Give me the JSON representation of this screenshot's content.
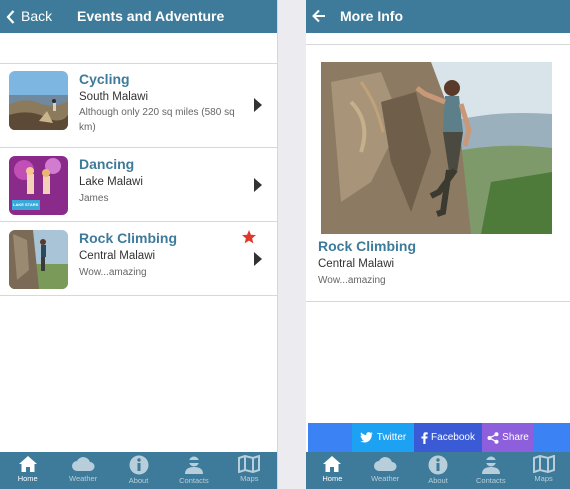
{
  "left": {
    "back_label": "Back",
    "title": "Events and Adventure",
    "items": [
      {
        "name": "Cycling",
        "location": "South Malawi",
        "description": "Although only 220 sq miles (580 sq km)",
        "favorite": false
      },
      {
        "name": "Dancing",
        "location": "Lake Malawi",
        "description": "James",
        "favorite": false
      },
      {
        "name": "Rock Climbing",
        "location": "Central Malawi",
        "description": "Wow...amazing",
        "favorite": true
      }
    ],
    "dancing_thumb_text": "LAKE STARS"
  },
  "right": {
    "title": "More Info",
    "detail": {
      "name": "Rock Climbing",
      "location": "Central Malawi",
      "description": "Wow...amazing"
    },
    "share": {
      "twitter": "Twitter",
      "facebook": "Facebook",
      "share": "Share"
    }
  },
  "tabs": [
    {
      "label": "Home",
      "icon": "home-icon"
    },
    {
      "label": "Weather",
      "icon": "cloud-icon"
    },
    {
      "label": "About",
      "icon": "info-icon"
    },
    {
      "label": "Contacts",
      "icon": "contact-icon"
    },
    {
      "label": "Maps",
      "icon": "map-icon"
    }
  ],
  "colors": {
    "header": "#3e7b9a",
    "accent_text": "#3e7b9a",
    "star": "#e0392b",
    "share_bar": "#3b82f5",
    "twitter": "#1da1f2",
    "facebook": "#3b5bd6",
    "share": "#8e5fdc"
  }
}
